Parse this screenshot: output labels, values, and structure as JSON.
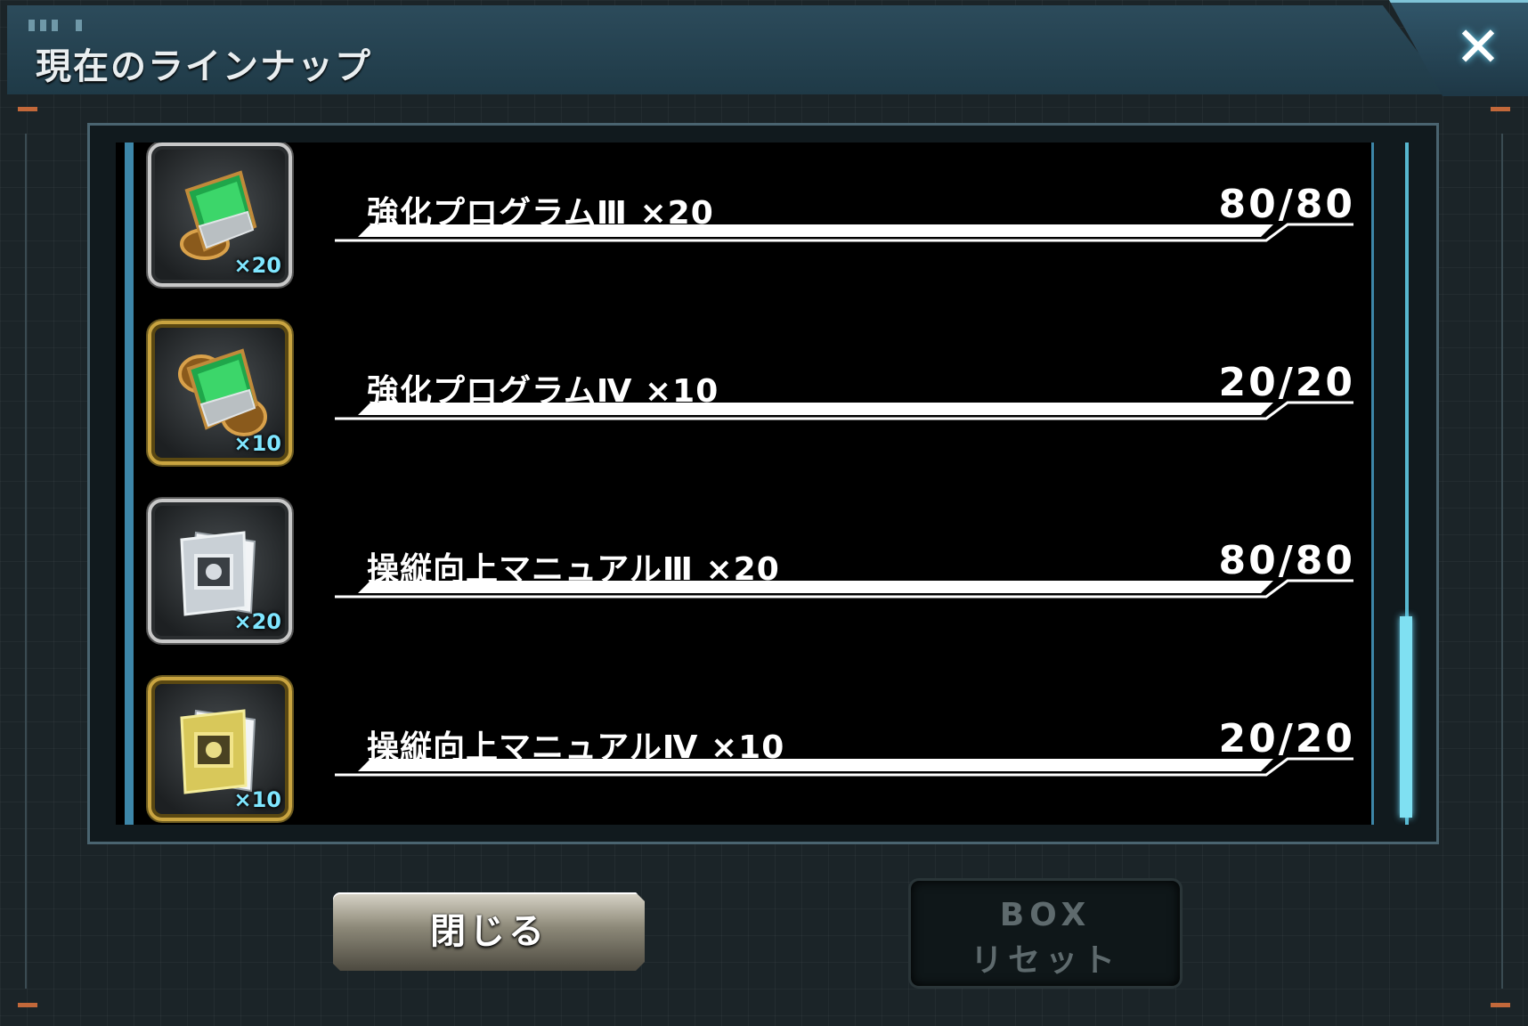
{
  "header": {
    "title": "現在のラインナップ",
    "close_icon": "close-x-icon"
  },
  "lineup": [
    {
      "name": "強化プログラムⅢ ×20",
      "count": "80/80",
      "badge": "×20",
      "icon": "enhancement-program-icon",
      "rarity": "silver"
    },
    {
      "name": "強化プログラムⅣ ×10",
      "count": "20/20",
      "badge": "×10",
      "icon": "enhancement-program-icon",
      "rarity": "gold"
    },
    {
      "name": "操縦向上マニュアルⅢ ×20",
      "count": "80/80",
      "badge": "×20",
      "icon": "piloting-manual-icon",
      "rarity": "silver"
    },
    {
      "name": "操縦向上マニュアルⅣ ×10",
      "count": "20/20",
      "badge": "×10",
      "icon": "piloting-manual-icon",
      "rarity": "gold"
    }
  ],
  "buttons": {
    "close_label": "閉じる",
    "reset_label_line1": "BOX",
    "reset_label_line2": "リセット",
    "reset_enabled": false
  },
  "colors": {
    "accent": "#57b7cf",
    "badge": "#7fe6ff",
    "gold_frame": "#c9a440",
    "silver_frame": "#c8c8c8"
  }
}
